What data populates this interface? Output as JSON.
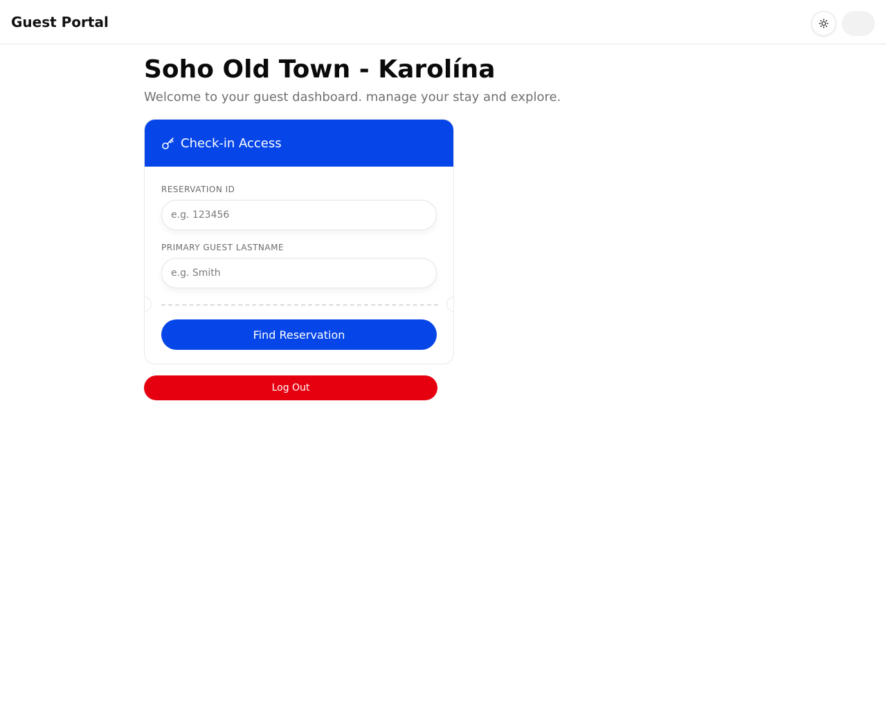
{
  "header": {
    "app_title": "Guest Portal",
    "theme_icon": "sun-icon"
  },
  "main": {
    "title": "Soho Old Town - Karolína",
    "subtitle": "Welcome to your guest dashboard. manage your stay and explore."
  },
  "checkin_card": {
    "icon": "key-icon",
    "title": "Check-in Access",
    "reservation_id": {
      "label": "RESERVATION ID",
      "placeholder": "e.g. 123456",
      "value": ""
    },
    "lastname": {
      "label": "PRIMARY GUEST LASTNAME",
      "placeholder": "e.g. Smith",
      "value": ""
    },
    "submit_label": "Find Reservation"
  },
  "logout_label": "Log Out",
  "colors": {
    "primary": "#0646e8",
    "danger": "#e6000f"
  }
}
